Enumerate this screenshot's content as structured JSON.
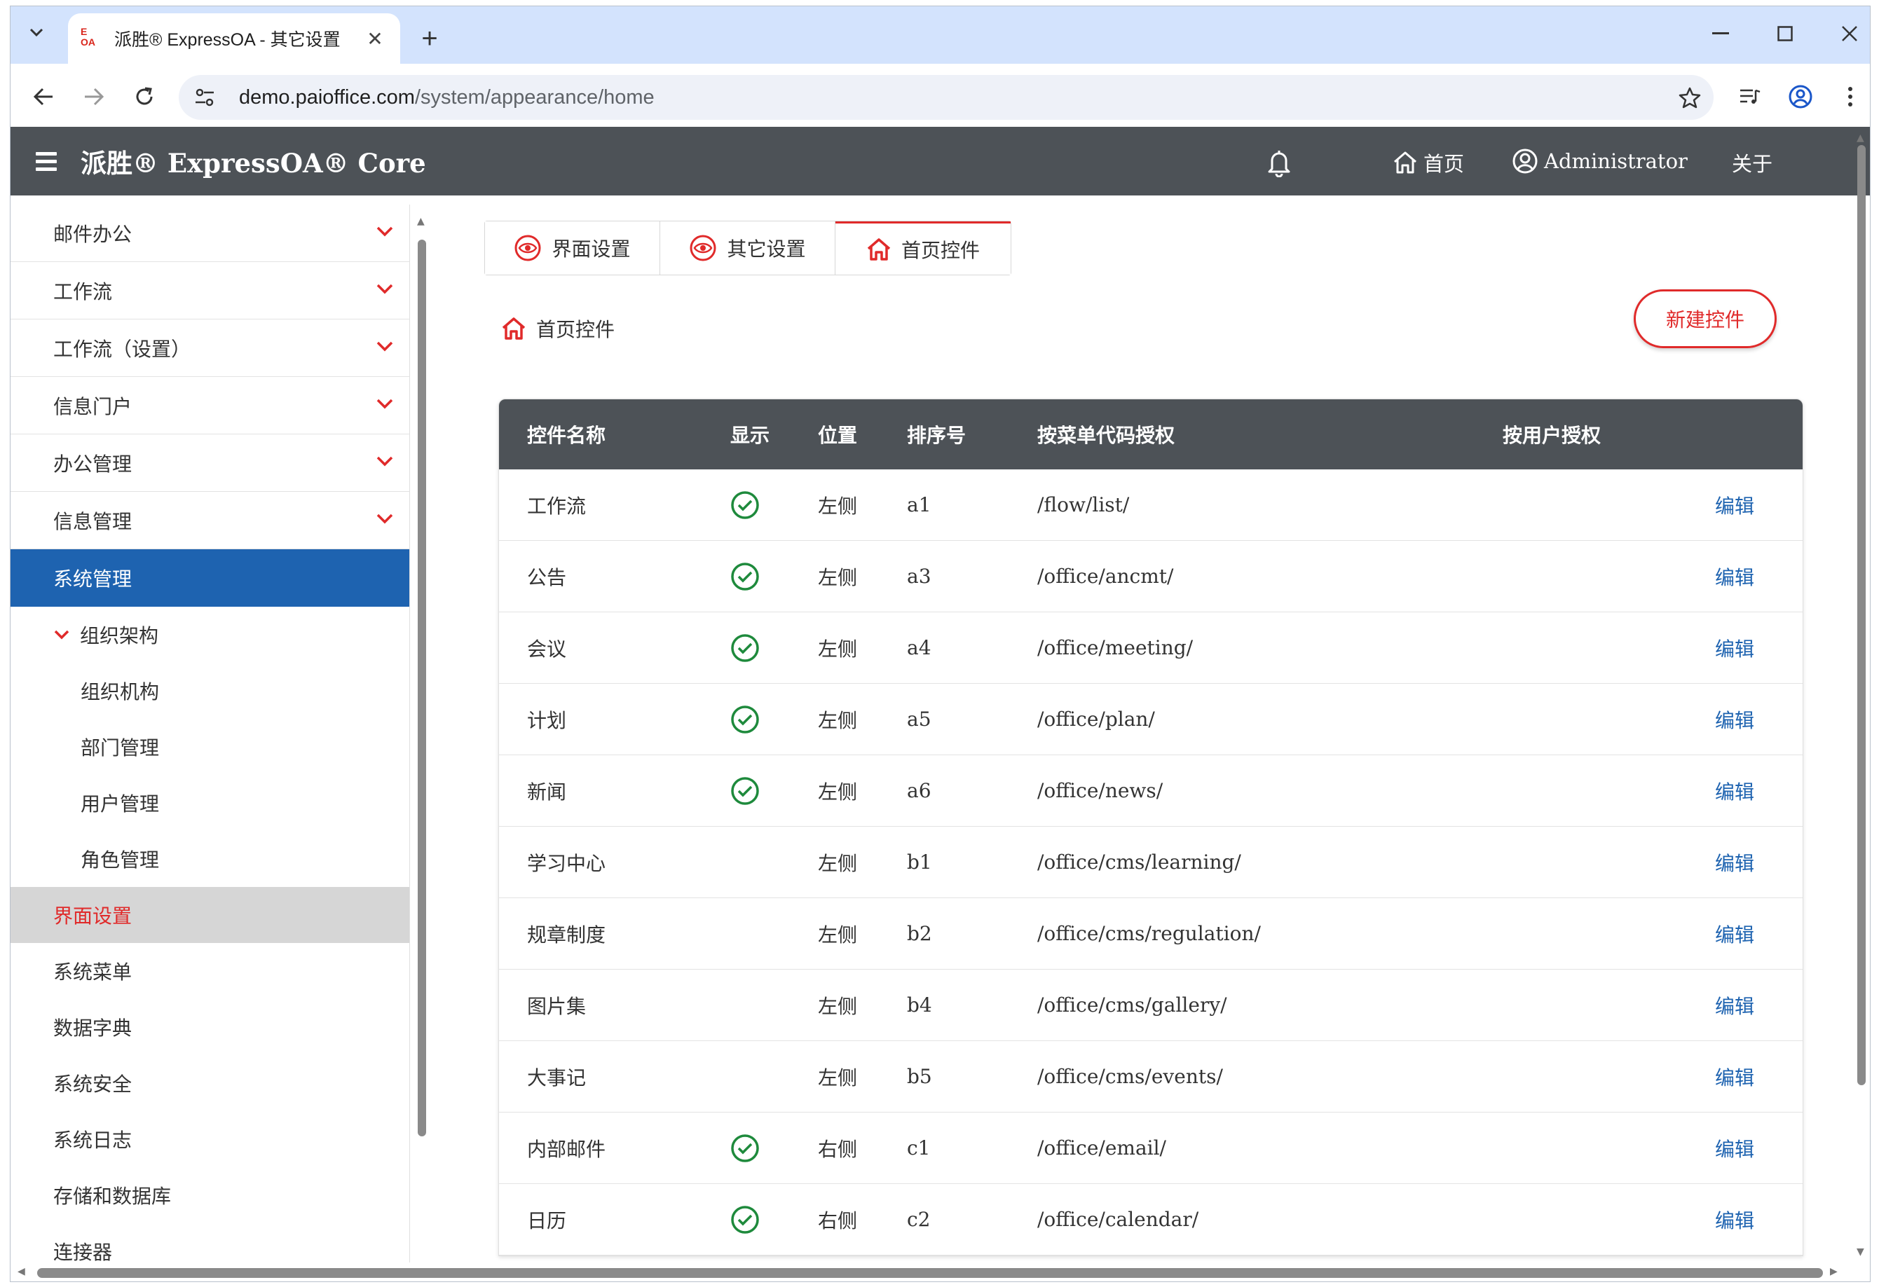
{
  "browser": {
    "tab_title": "派胜® ExpressOA - 其它设置",
    "favicon_text": "E\nOA",
    "url_host": "demo.paioffice.com",
    "url_path": "/system/appearance/home"
  },
  "header": {
    "brand": "派胜® ExpressOA® Core",
    "home": "首页",
    "user": "Administrator",
    "about": "关于"
  },
  "sidebar": {
    "items": [
      {
        "label": "邮件办公"
      },
      {
        "label": "工作流"
      },
      {
        "label": "工作流（设置）"
      },
      {
        "label": "信息门户"
      },
      {
        "label": "办公管理"
      },
      {
        "label": "信息管理"
      },
      {
        "label": "系统管理"
      }
    ],
    "group": "组织架构",
    "group_items": [
      "组织机构",
      "部门管理",
      "用户管理",
      "角色管理"
    ],
    "selected": "界面设置",
    "rest": [
      "系统菜单",
      "数据字典",
      "系统安全",
      "系统日志",
      "存储和数据库",
      "连接器"
    ]
  },
  "tabs": [
    "界面设置",
    "其它设置",
    "首页控件"
  ],
  "breadcrumb": "首页控件",
  "new_button": "新建控件",
  "table": {
    "headers": [
      "控件名称",
      "显示",
      "位置",
      "排序号",
      "按菜单代码授权",
      "按用户授权"
    ],
    "edit_label": "编辑",
    "rows": [
      {
        "name": "工作流",
        "show": true,
        "pos": "左侧",
        "order": "a1",
        "menu": "/flow/list/"
      },
      {
        "name": "公告",
        "show": true,
        "pos": "左侧",
        "order": "a3",
        "menu": "/office/ancmt/"
      },
      {
        "name": "会议",
        "show": true,
        "pos": "左侧",
        "order": "a4",
        "menu": "/office/meeting/"
      },
      {
        "name": "计划",
        "show": true,
        "pos": "左侧",
        "order": "a5",
        "menu": "/office/plan/"
      },
      {
        "name": "新闻",
        "show": true,
        "pos": "左侧",
        "order": "a6",
        "menu": "/office/news/"
      },
      {
        "name": "学习中心",
        "show": false,
        "pos": "左侧",
        "order": "b1",
        "menu": "/office/cms/learning/"
      },
      {
        "name": "规章制度",
        "show": false,
        "pos": "左侧",
        "order": "b2",
        "menu": "/office/cms/regulation/"
      },
      {
        "name": "图片集",
        "show": false,
        "pos": "左侧",
        "order": "b4",
        "menu": "/office/cms/gallery/"
      },
      {
        "name": "大事记",
        "show": false,
        "pos": "左侧",
        "order": "b5",
        "menu": "/office/cms/events/"
      },
      {
        "name": "内部邮件",
        "show": true,
        "pos": "右侧",
        "order": "c1",
        "menu": "/office/email/"
      },
      {
        "name": "日历",
        "show": true,
        "pos": "右侧",
        "order": "c2",
        "menu": "/office/calendar/"
      }
    ]
  },
  "colors": {
    "accent": "#e02a2a",
    "header_bg": "#4d5257",
    "active_blue": "#1e63b0",
    "check_green": "#1e8a3c"
  }
}
